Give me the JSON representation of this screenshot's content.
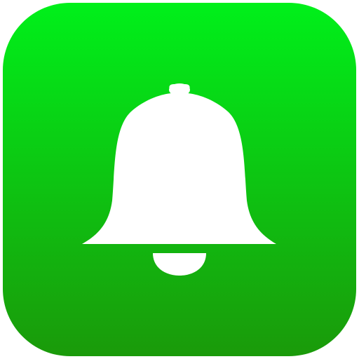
{
  "app_icon": {
    "icon": "bell-icon",
    "colors": {
      "gradient_top": "#00f01a",
      "gradient_bottom": "#1a9a0a",
      "glyph": "#ffffff"
    }
  }
}
